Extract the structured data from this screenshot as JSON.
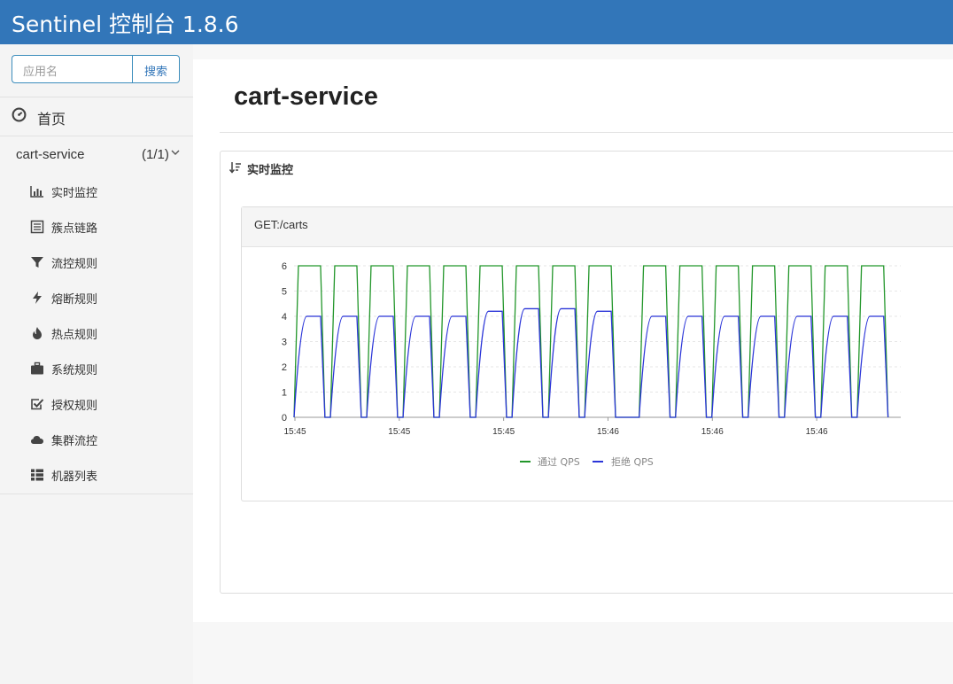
{
  "header": {
    "title": "Sentinel 控制台 1.8.6"
  },
  "sidebar": {
    "search": {
      "placeholder": "应用名",
      "button": "搜索"
    },
    "home": {
      "label": "首页",
      "icon": "dashboard-icon"
    },
    "app": {
      "name": "cart-service",
      "count": "(1/1)",
      "icon": "chevron-down-icon"
    },
    "items": [
      {
        "label": "实时监控",
        "icon": "bar-chart-icon"
      },
      {
        "label": "簇点链路",
        "icon": "list-icon"
      },
      {
        "label": "流控规则",
        "icon": "filter-icon"
      },
      {
        "label": "熔断规则",
        "icon": "bolt-icon"
      },
      {
        "label": "热点规则",
        "icon": "fire-icon"
      },
      {
        "label": "系统规则",
        "icon": "briefcase-icon"
      },
      {
        "label": "授权规则",
        "icon": "check-square-icon"
      },
      {
        "label": "集群流控",
        "icon": "cloud-icon"
      },
      {
        "label": "机器列表",
        "icon": "th-list-icon"
      }
    ]
  },
  "main": {
    "title": "cart-service",
    "panel": {
      "title": "实时监控",
      "icon": "sort-icon"
    },
    "card": {
      "resource": "GET:/carts"
    }
  },
  "colors": {
    "header": "#3276b9",
    "pass": "#22962a",
    "block": "#2b35d8"
  },
  "chart_data": {
    "type": "line",
    "ylim": [
      0,
      6
    ],
    "yticks": [
      0,
      1,
      2,
      3,
      4,
      5,
      6
    ],
    "xtick_labels": [
      "15:45",
      "15:45",
      "15:45",
      "15:46",
      "15:46",
      "15:46"
    ],
    "legend_position": "bottom",
    "grid": true,
    "series": [
      {
        "name": "通过 QPS",
        "color": "#22962a"
      },
      {
        "name": "拒绝 QPS",
        "color": "#2b35d8"
      }
    ],
    "cycles": [
      {
        "start": 0.0,
        "pass_top": 6,
        "block_top": 4
      },
      {
        "start": 1.0,
        "pass_top": 6,
        "block_top": 4
      },
      {
        "start": 2.0,
        "pass_top": 6,
        "block_top": 4
      },
      {
        "start": 3.0,
        "pass_top": 6,
        "block_top": 4
      },
      {
        "start": 4.0,
        "pass_top": 6,
        "block_top": 4
      },
      {
        "start": 5.0,
        "pass_top": 6,
        "block_top": 4.2
      },
      {
        "start": 6.0,
        "pass_top": 6,
        "block_top": 4.3
      },
      {
        "start": 7.0,
        "pass_top": 6,
        "block_top": 4.3
      },
      {
        "start": 8.0,
        "pass_top": 6,
        "block_top": 4.2
      },
      {
        "start": 9.5,
        "pass_top": 6,
        "block_top": 4
      },
      {
        "start": 10.5,
        "pass_top": 6,
        "block_top": 4
      },
      {
        "start": 11.5,
        "pass_top": 6,
        "block_top": 4
      },
      {
        "start": 12.5,
        "pass_top": 6,
        "block_top": 4
      },
      {
        "start": 13.5,
        "pass_top": 6,
        "block_top": 4
      },
      {
        "start": 14.5,
        "pass_top": 6,
        "block_top": 4
      },
      {
        "start": 15.5,
        "pass_top": 6,
        "block_top": 4
      }
    ]
  }
}
